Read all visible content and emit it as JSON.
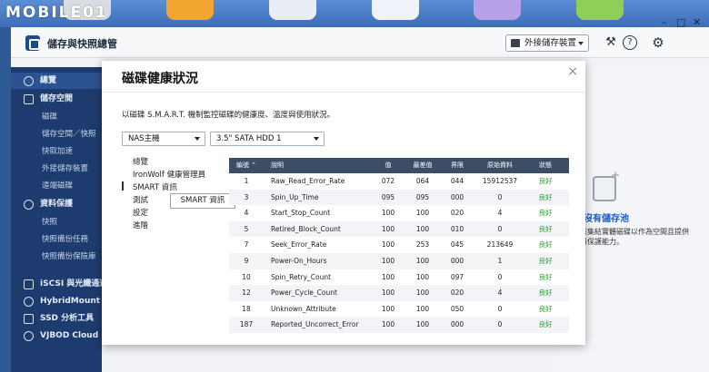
{
  "watermark": "MOBILE01",
  "app": {
    "title": "儲存與快照總管",
    "ext_storage_button": "外接儲存裝置",
    "window_controls": [
      "–",
      "□",
      "✕"
    ]
  },
  "sidebar": {
    "items": [
      {
        "label": "總覽",
        "type": "top",
        "icon": "gauge-icon"
      },
      {
        "label": "儲存空間",
        "type": "top",
        "icon": "database-icon"
      },
      {
        "label": "磁碟",
        "type": "sub"
      },
      {
        "label": "儲存空間／快照",
        "type": "sub"
      },
      {
        "label": "快取加速",
        "type": "sub"
      },
      {
        "label": "外接儲存裝置",
        "type": "sub"
      },
      {
        "label": "遠端磁碟",
        "type": "sub"
      },
      {
        "label": "資料保護",
        "type": "top",
        "icon": "shield-icon"
      },
      {
        "label": "快照",
        "type": "sub"
      },
      {
        "label": "快照備份任務",
        "type": "sub"
      },
      {
        "label": "快照備份保險庫",
        "type": "sub"
      },
      {
        "label": "iSCSI 與光纖通道",
        "type": "top",
        "icon": "iscsi-icon"
      },
      {
        "label": "HybridMount",
        "type": "top",
        "icon": "cloud-icon"
      },
      {
        "label": "SSD 分析工具",
        "type": "top",
        "icon": "ssd-icon"
      },
      {
        "label": "VJBOD Cloud",
        "type": "top",
        "icon": "vjbod-icon"
      }
    ]
  },
  "right_pane": {
    "title": "沒有儲存池",
    "desc": "用來集結實體磁碟以作為空間且提供資料保護能力。"
  },
  "modal": {
    "title": "磁碟健康狀況",
    "close": "×",
    "description": "以磁碟 S.M.A.R.T. 機制監控磁碟的健康度、溫度與使用狀況。",
    "select_device": "NAS主機",
    "select_disk": "3.5\" SATA HDD 1",
    "nav": [
      "總覽",
      "IronWolf 健康管理員",
      "SMART 資訊",
      "測試",
      "設定",
      "進階"
    ],
    "nav_active_index": 2,
    "tooltip": "SMART 資訊",
    "table": {
      "headers": [
        "編號 ⌃",
        "說明",
        "值",
        "最差值",
        "界限",
        "原始資料",
        "狀態"
      ],
      "rows": [
        [
          "1",
          "Raw_Read_Error_Rate",
          "072",
          "064",
          "044",
          "15912537",
          "良好"
        ],
        [
          "3",
          "Spin_Up_Time",
          "095",
          "095",
          "000",
          "0",
          "良好"
        ],
        [
          "4",
          "Start_Stop_Count",
          "100",
          "100",
          "020",
          "4",
          "良好"
        ],
        [
          "5",
          "Retired_Block_Count",
          "100",
          "100",
          "010",
          "0",
          "良好"
        ],
        [
          "7",
          "Seek_Error_Rate",
          "100",
          "253",
          "045",
          "213649",
          "良好"
        ],
        [
          "9",
          "Power-On_Hours",
          "100",
          "100",
          "000",
          "1",
          "良好"
        ],
        [
          "10",
          "Spin_Retry_Count",
          "100",
          "100",
          "097",
          "0",
          "良好"
        ],
        [
          "12",
          "Power_Cycle_Count",
          "100",
          "100",
          "020",
          "4",
          "良好"
        ],
        [
          "18",
          "Unknown_Attribute",
          "100",
          "100",
          "050",
          "0",
          "良好"
        ],
        [
          "187",
          "Reported_Uncorrect_Error",
          "100",
          "100",
          "000",
          "0",
          "良好"
        ]
      ]
    }
  },
  "colors": {
    "sidebar_bg": "#1d3b6e",
    "table_header_bg": "#3c4d65",
    "status_good": "#2f9a36",
    "accent": "#1f5bb8"
  }
}
